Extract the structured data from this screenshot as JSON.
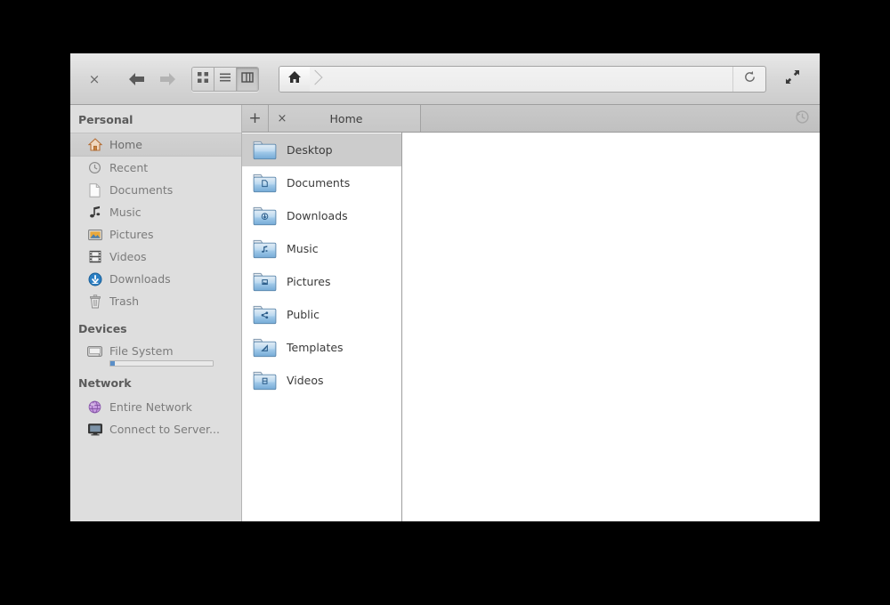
{
  "window": {
    "title": "Home"
  },
  "toolbar": {
    "close_label": "×",
    "back_icon": "back-arrow-icon",
    "forward_icon": "forward-arrow-icon",
    "view_modes": [
      {
        "name": "icon-view",
        "label": "Icon View",
        "active": false
      },
      {
        "name": "list-view",
        "label": "List View",
        "active": false
      },
      {
        "name": "column-view",
        "label": "Column View",
        "active": true
      }
    ],
    "path_home_icon": "home-icon",
    "reload_icon": "reload-icon",
    "fullscreen_icon": "fullscreen-icon"
  },
  "sidebar": {
    "sections": [
      {
        "heading": "Personal",
        "items": [
          {
            "label": "Home",
            "icon": "home-icon",
            "selected": true
          },
          {
            "label": "Recent",
            "icon": "recent-clock-icon",
            "selected": false
          },
          {
            "label": "Documents",
            "icon": "document-icon",
            "selected": false
          },
          {
            "label": "Music",
            "icon": "music-note-icon",
            "selected": false
          },
          {
            "label": "Pictures",
            "icon": "picture-icon",
            "selected": false
          },
          {
            "label": "Videos",
            "icon": "film-icon",
            "selected": false
          },
          {
            "label": "Downloads",
            "icon": "download-icon",
            "selected": false
          },
          {
            "label": "Trash",
            "icon": "trash-icon",
            "selected": false
          }
        ]
      },
      {
        "heading": "Devices",
        "items": [
          {
            "label": "File System",
            "icon": "harddisk-icon",
            "selected": false,
            "capacity_percent": 4
          }
        ]
      },
      {
        "heading": "Network",
        "items": [
          {
            "label": "Entire Network",
            "icon": "network-globe-icon",
            "selected": false
          },
          {
            "label": "Connect to Server...",
            "icon": "monitor-icon",
            "selected": false
          }
        ]
      }
    ]
  },
  "tabbar": {
    "new_tab_label": "+",
    "tabs": [
      {
        "title": "Home",
        "close_label": "×",
        "active": true
      }
    ],
    "history_icon": "history-icon"
  },
  "file_list": {
    "items": [
      {
        "name": "Desktop",
        "emblem": "none",
        "selected": true
      },
      {
        "name": "Documents",
        "emblem": "document",
        "selected": false
      },
      {
        "name": "Downloads",
        "emblem": "download",
        "selected": false
      },
      {
        "name": "Music",
        "emblem": "music",
        "selected": false
      },
      {
        "name": "Pictures",
        "emblem": "picture",
        "selected": false
      },
      {
        "name": "Public",
        "emblem": "share",
        "selected": false
      },
      {
        "name": "Templates",
        "emblem": "template",
        "selected": false
      },
      {
        "name": "Videos",
        "emblem": "video",
        "selected": false
      }
    ]
  },
  "colors": {
    "selection": "#cccccc",
    "sidebar_bg": "#dedede",
    "folder_blue": "#93c3e8",
    "capacity_fill": "#5a8fc8",
    "home_icon": "#c87a3c"
  }
}
